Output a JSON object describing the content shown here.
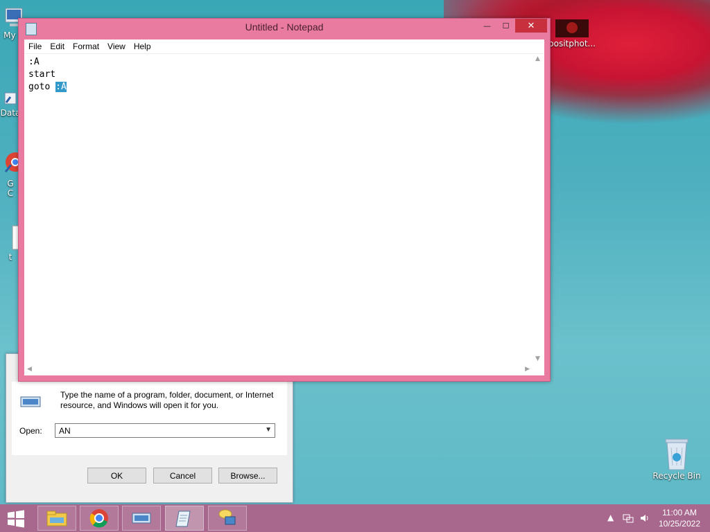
{
  "desktop": {
    "icons": [
      {
        "label": "My C"
      },
      {
        "label": "Data"
      },
      {
        "label": "G\nC"
      },
      {
        "label": "t"
      },
      {
        "label": "positphot..."
      },
      {
        "label": "Recycle Bin"
      }
    ]
  },
  "notepad": {
    "title": "Untitled - Notepad",
    "menu": [
      "File",
      "Edit",
      "Format",
      "View",
      "Help"
    ],
    "content_before": ":A\nstart\ngoto ",
    "selected_text": ":A",
    "controls": {
      "minimize": "—",
      "maximize": "☐",
      "close": "✕"
    }
  },
  "run_dialog": {
    "description": "Type the name of a program, folder, document, or Internet resource, and Windows will open it for you.",
    "open_label": "Open:",
    "open_value": "AN",
    "buttons": {
      "ok": "OK",
      "cancel": "Cancel",
      "browse": "Browse..."
    }
  },
  "taskbar": {
    "apps": [
      "file-explorer",
      "chrome",
      "run",
      "notepad",
      "remote-desktop"
    ],
    "active_app": "notepad",
    "time": "11:00 AM",
    "date": "10/25/2022"
  },
  "colors": {
    "notepad_frame": "#e97aa0",
    "close_button": "#c7303c",
    "selection": "#3399c9",
    "taskbar": "#af5f87"
  }
}
